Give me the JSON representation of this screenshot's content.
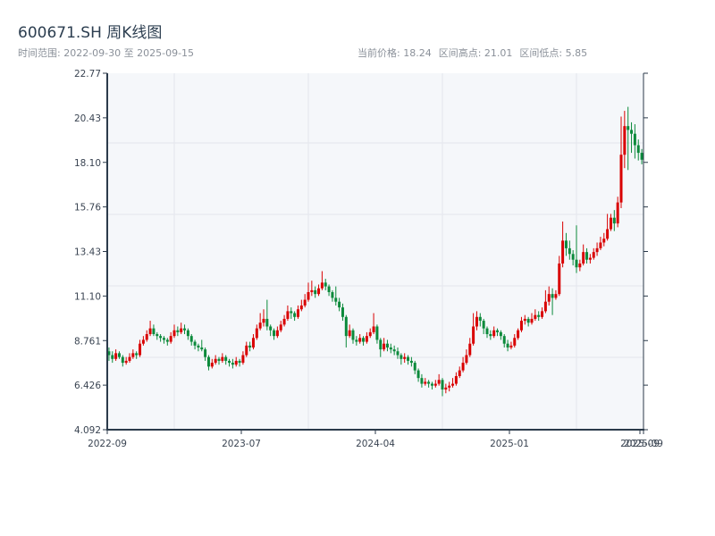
{
  "header": {
    "title": "600671.SH 周K线图",
    "range_label": "时间范围: 2022-09-30 至 2025-09-15",
    "current_price": "当前价格: 18.24",
    "period_high": "区间高点: 21.01",
    "period_low": "区间低点: 5.85"
  },
  "chart_data": {
    "type": "candlestick",
    "title": "600671.SH 周K线图",
    "x_start": "2022-09-30",
    "x_end": "2025-09-15",
    "interval": "weekly",
    "ohlc_order": [
      "open",
      "high",
      "low",
      "close"
    ],
    "ylim": [
      4.092,
      22.77
    ],
    "y_ticks": [
      "4.092",
      "6.426",
      "8.761",
      "11.10",
      "13.43",
      "15.76",
      "18.10",
      "20.43",
      "22.77"
    ],
    "x_ticks": [
      "2022-09",
      "2023-07",
      "2024-04",
      "2025-01",
      "2025-09",
      "2025-09"
    ],
    "grid": true,
    "colors": {
      "up": "#d90000",
      "down": "#0b8a3b",
      "background": "#f5f7fa",
      "axis": "#2b3a4a",
      "grid": "#e3e6ec"
    },
    "candles": [
      [
        8.2,
        8.4,
        7.7,
        8.0
      ],
      [
        8.0,
        8.2,
        7.6,
        7.8
      ],
      [
        7.8,
        8.3,
        7.7,
        8.1
      ],
      [
        8.1,
        8.2,
        7.8,
        7.9
      ],
      [
        7.9,
        8.0,
        7.4,
        7.6
      ],
      [
        7.6,
        7.9,
        7.5,
        7.7
      ],
      [
        7.7,
        8.1,
        7.6,
        7.9
      ],
      [
        7.9,
        8.3,
        7.8,
        8.1
      ],
      [
        8.1,
        8.2,
        7.8,
        8.0
      ],
      [
        8.0,
        8.8,
        7.9,
        8.6
      ],
      [
        8.6,
        9.0,
        8.5,
        8.8
      ],
      [
        8.8,
        9.3,
        8.7,
        9.1
      ],
      [
        9.1,
        9.8,
        9.0,
        9.4
      ],
      [
        9.4,
        9.6,
        9.0,
        9.1
      ],
      [
        9.1,
        9.2,
        8.8,
        9.0
      ],
      [
        9.0,
        9.1,
        8.7,
        8.9
      ],
      [
        8.9,
        9.0,
        8.6,
        8.8
      ],
      [
        8.8,
        8.9,
        8.5,
        8.7
      ],
      [
        8.7,
        9.2,
        8.6,
        9.0
      ],
      [
        9.0,
        9.6,
        8.9,
        9.3
      ],
      [
        9.3,
        9.5,
        9.0,
        9.2
      ],
      [
        9.2,
        9.7,
        9.1,
        9.4
      ],
      [
        9.4,
        9.6,
        9.1,
        9.3
      ],
      [
        9.3,
        9.4,
        8.8,
        9.0
      ],
      [
        9.0,
        9.1,
        8.5,
        8.7
      ],
      [
        8.7,
        8.8,
        8.3,
        8.5
      ],
      [
        8.5,
        8.6,
        8.2,
        8.4
      ],
      [
        8.4,
        8.8,
        8.2,
        8.3
      ],
      [
        8.3,
        8.4,
        7.7,
        7.9
      ],
      [
        7.9,
        8.0,
        7.2,
        7.4
      ],
      [
        7.4,
        7.8,
        7.3,
        7.6
      ],
      [
        7.6,
        8.0,
        7.5,
        7.8
      ],
      [
        7.8,
        7.9,
        7.5,
        7.7
      ],
      [
        7.7,
        8.1,
        7.6,
        7.9
      ],
      [
        7.9,
        8.0,
        7.5,
        7.7
      ],
      [
        7.7,
        7.8,
        7.4,
        7.6
      ],
      [
        7.6,
        7.8,
        7.3,
        7.5
      ],
      [
        7.5,
        7.9,
        7.4,
        7.7
      ],
      [
        7.7,
        7.8,
        7.4,
        7.6
      ],
      [
        7.6,
        8.2,
        7.5,
        8.0
      ],
      [
        8.0,
        8.7,
        7.9,
        8.5
      ],
      [
        8.5,
        8.7,
        8.2,
        8.4
      ],
      [
        8.4,
        9.1,
        8.3,
        8.9
      ],
      [
        8.9,
        9.6,
        8.8,
        9.4
      ],
      [
        9.4,
        10.2,
        9.3,
        9.7
      ],
      [
        9.7,
        10.4,
        9.5,
        9.9
      ],
      [
        9.9,
        10.9,
        9.3,
        9.5
      ],
      [
        9.5,
        9.6,
        9.0,
        9.3
      ],
      [
        9.3,
        9.4,
        8.8,
        9.0
      ],
      [
        9.0,
        9.5,
        8.9,
        9.3
      ],
      [
        9.3,
        9.8,
        9.2,
        9.6
      ],
      [
        9.6,
        10.1,
        9.5,
        9.9
      ],
      [
        9.9,
        10.6,
        9.8,
        10.3
      ],
      [
        10.3,
        10.5,
        9.9,
        10.2
      ],
      [
        10.2,
        10.3,
        9.8,
        10.0
      ],
      [
        10.0,
        10.6,
        9.9,
        10.4
      ],
      [
        10.4,
        10.9,
        10.3,
        10.6
      ],
      [
        10.6,
        11.2,
        10.5,
        10.9
      ],
      [
        10.9,
        11.8,
        10.8,
        11.3
      ],
      [
        11.3,
        11.9,
        11.1,
        11.4
      ],
      [
        11.4,
        11.6,
        11.0,
        11.2
      ],
      [
        11.2,
        11.7,
        11.1,
        11.5
      ],
      [
        11.5,
        12.4,
        11.4,
        11.8
      ],
      [
        11.8,
        12.0,
        11.4,
        11.6
      ],
      [
        11.6,
        11.7,
        11.1,
        11.3
      ],
      [
        11.3,
        11.4,
        10.8,
        11.0
      ],
      [
        11.0,
        11.6,
        10.6,
        10.8
      ],
      [
        10.8,
        11.0,
        10.3,
        10.5
      ],
      [
        10.5,
        10.7,
        9.8,
        10.0
      ],
      [
        10.0,
        10.1,
        8.4,
        9.0
      ],
      [
        9.0,
        9.6,
        8.9,
        9.3
      ],
      [
        9.3,
        9.4,
        8.6,
        8.8
      ],
      [
        8.8,
        9.0,
        8.5,
        8.7
      ],
      [
        8.7,
        9.1,
        8.6,
        8.9
      ],
      [
        8.9,
        9.0,
        8.5,
        8.7
      ],
      [
        8.7,
        9.2,
        8.6,
        9.0
      ],
      [
        9.0,
        9.4,
        8.9,
        9.2
      ],
      [
        9.2,
        10.2,
        9.1,
        9.5
      ],
      [
        9.5,
        9.6,
        8.6,
        8.8
      ],
      [
        8.8,
        8.9,
        7.9,
        8.3
      ],
      [
        8.3,
        8.9,
        8.2,
        8.6
      ],
      [
        8.6,
        8.8,
        8.2,
        8.4
      ],
      [
        8.4,
        8.6,
        8.1,
        8.3
      ],
      [
        8.3,
        8.5,
        8.0,
        8.2
      ],
      [
        8.2,
        8.4,
        7.8,
        8.0
      ],
      [
        8.0,
        8.1,
        7.5,
        7.8
      ],
      [
        7.8,
        8.1,
        7.6,
        7.9
      ],
      [
        7.9,
        8.0,
        7.5,
        7.7
      ],
      [
        7.7,
        7.9,
        7.4,
        7.6
      ],
      [
        7.6,
        7.7,
        7.0,
        7.2
      ],
      [
        7.2,
        7.3,
        6.6,
        6.8
      ],
      [
        6.8,
        7.0,
        6.3,
        6.5
      ],
      [
        6.5,
        6.8,
        6.4,
        6.6
      ],
      [
        6.6,
        6.7,
        6.3,
        6.5
      ],
      [
        6.5,
        6.6,
        6.2,
        6.4
      ],
      [
        6.4,
        6.7,
        6.3,
        6.5
      ],
      [
        6.5,
        7.0,
        6.4,
        6.7
      ],
      [
        6.7,
        6.8,
        5.85,
        6.2
      ],
      [
        6.2,
        6.5,
        6.0,
        6.3
      ],
      [
        6.3,
        6.6,
        6.1,
        6.4
      ],
      [
        6.4,
        6.8,
        6.3,
        6.5
      ],
      [
        6.5,
        7.1,
        6.4,
        6.9
      ],
      [
        6.9,
        7.4,
        6.8,
        7.2
      ],
      [
        7.2,
        7.9,
        7.1,
        7.6
      ],
      [
        7.6,
        8.3,
        7.5,
        8.0
      ],
      [
        8.0,
        8.9,
        7.9,
        8.6
      ],
      [
        8.6,
        10.2,
        8.5,
        9.5
      ],
      [
        9.5,
        10.3,
        9.3,
        10.0
      ],
      [
        10.0,
        10.2,
        9.5,
        9.8
      ],
      [
        9.8,
        9.9,
        9.1,
        9.4
      ],
      [
        9.4,
        9.5,
        8.9,
        9.1
      ],
      [
        9.1,
        9.3,
        8.8,
        9.0
      ],
      [
        9.0,
        9.5,
        8.9,
        9.3
      ],
      [
        9.3,
        9.4,
        9.0,
        9.2
      ],
      [
        9.2,
        9.3,
        8.8,
        9.0
      ],
      [
        9.0,
        9.1,
        8.4,
        8.6
      ],
      [
        8.6,
        8.8,
        8.2,
        8.4
      ],
      [
        8.4,
        8.7,
        8.3,
        8.5
      ],
      [
        8.5,
        9.1,
        8.4,
        8.9
      ],
      [
        8.9,
        9.4,
        8.8,
        9.3
      ],
      [
        9.3,
        10.0,
        9.2,
        9.8
      ],
      [
        9.8,
        10.1,
        9.6,
        9.9
      ],
      [
        9.9,
        10.0,
        9.5,
        9.7
      ],
      [
        9.7,
        10.2,
        9.6,
        9.9
      ],
      [
        9.9,
        10.4,
        9.8,
        10.1
      ],
      [
        10.1,
        10.3,
        9.8,
        10.0
      ],
      [
        10.0,
        10.5,
        9.9,
        10.3
      ],
      [
        10.3,
        11.4,
        10.2,
        10.8
      ],
      [
        10.8,
        11.6,
        10.6,
        11.2
      ],
      [
        11.2,
        11.5,
        10.1,
        11.0
      ],
      [
        11.0,
        11.4,
        10.9,
        11.2
      ],
      [
        11.2,
        13.2,
        11.1,
        12.8
      ],
      [
        12.8,
        15.0,
        12.6,
        14.0
      ],
      [
        14.0,
        14.4,
        13.2,
        13.6
      ],
      [
        13.6,
        14.0,
        13.0,
        13.3
      ],
      [
        13.3,
        13.5,
        12.7,
        13.0
      ],
      [
        13.0,
        14.8,
        12.3,
        12.6
      ],
      [
        12.6,
        13.0,
        12.4,
        12.8
      ],
      [
        12.8,
        13.8,
        12.7,
        13.4
      ],
      [
        13.4,
        13.6,
        12.8,
        13.0
      ],
      [
        13.0,
        13.3,
        12.8,
        13.1
      ],
      [
        13.1,
        13.6,
        13.0,
        13.4
      ],
      [
        13.4,
        13.9,
        13.2,
        13.6
      ],
      [
        13.6,
        14.2,
        13.5,
        13.9
      ],
      [
        13.9,
        14.4,
        13.7,
        14.1
      ],
      [
        14.1,
        15.4,
        14.0,
        14.6
      ],
      [
        14.6,
        15.4,
        14.5,
        15.2
      ],
      [
        15.2,
        15.6,
        14.5,
        14.9
      ],
      [
        14.9,
        16.3,
        14.7,
        16.0
      ],
      [
        16.0,
        20.5,
        15.7,
        18.5
      ],
      [
        18.5,
        20.8,
        17.8,
        20.0
      ],
      [
        20.0,
        21.01,
        17.7,
        19.8
      ],
      [
        19.8,
        20.2,
        18.6,
        19.6
      ],
      [
        19.6,
        20.1,
        18.3,
        19.0
      ],
      [
        19.0,
        19.3,
        18.2,
        18.6
      ],
      [
        18.6,
        18.8,
        18.0,
        18.24
      ]
    ]
  }
}
